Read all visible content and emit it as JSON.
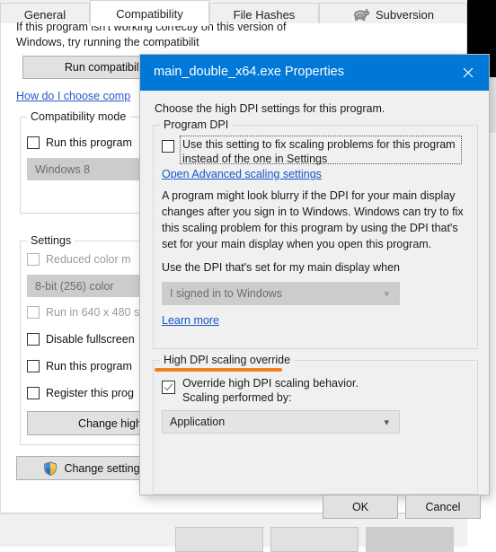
{
  "window": {
    "tabs": [
      {
        "label": "General",
        "selected": false,
        "icon": null
      },
      {
        "label": "Compatibility",
        "selected": true,
        "icon": null
      },
      {
        "label": "File Hashes",
        "selected": false,
        "icon": null
      },
      {
        "label": "Subversion",
        "selected": false,
        "icon": "tortoise-icon"
      }
    ]
  },
  "compat_tab": {
    "intro": "If this program isn't working correctly on this version of Windows, try running the compatibilit",
    "run_troubleshooter_label": "Run compatibility tr",
    "help_link": "How do I choose comp",
    "compatibility_mode": {
      "title": "Compatibility mode",
      "checkbox_label": "Run this program",
      "combo_value": "Windows 8"
    },
    "settings": {
      "title": "Settings",
      "reduced_color_label": "Reduced color m",
      "color_combo_value": "8-bit (256) color",
      "run640_label": "Run in 640 x 480 s",
      "disable_fullscreen_label": "Disable fullscreen",
      "run_as_admin_label": "Run this program",
      "register_label": "Register this prog",
      "change_high_dpi_label": "Change high"
    },
    "change_settings_label": "Change setting",
    "shield_icon": "uac-shield-icon"
  },
  "footer": {
    "ok_label": "",
    "cancel_label": "",
    "apply_label": ""
  },
  "dialog": {
    "title": "main_double_x64.exe Properties",
    "close_icon": "close-icon",
    "heading": "Choose the high DPI settings for this program.",
    "program_dpi": {
      "title": "Program DPI",
      "checkbox_label": "Use this setting to fix scaling problems for this program instead of the one in Settings",
      "checkbox_checked": false,
      "advanced_link": "Open Advanced scaling settings",
      "paragraph": "A program might look blurry if the DPI for your main display changes after you sign in to Windows. Windows can try to fix this scaling problem for this program by using the DPI that's set for your main display when you open this program.",
      "combo_label": "Use the DPI that's set for my main display when",
      "combo_value": "I signed in to Windows",
      "combo_disabled": true,
      "learn_more_link": "Learn more"
    },
    "high_dpi_override": {
      "title": "High DPI scaling override",
      "annotation_color": "#f07f21",
      "checkbox_label_line1": "Override high DPI scaling behavior.",
      "checkbox_label_line2": "Scaling performed by:",
      "checkbox_checked": true,
      "combo_value": "Application"
    },
    "ok_label": "OK",
    "cancel_label": "Cancel"
  },
  "colors": {
    "titlebar": "#0078d7",
    "link": "#1657c8",
    "annotation": "#f07f21"
  }
}
